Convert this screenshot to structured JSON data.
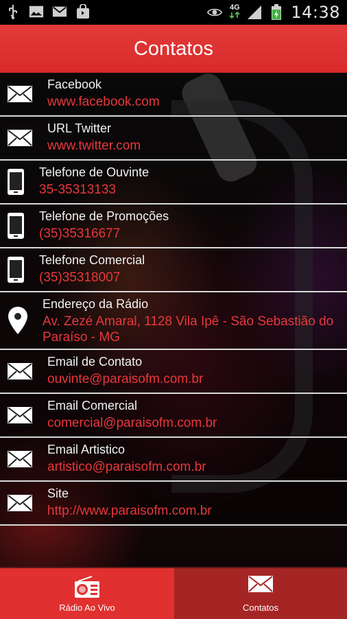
{
  "status_bar": {
    "network_label": "4G",
    "time": "14:38"
  },
  "header": {
    "title": "Contatos"
  },
  "contacts": [
    {
      "icon": "mail-icon",
      "label": "Facebook",
      "value": "www.facebook.com"
    },
    {
      "icon": "mail-icon",
      "label": "URL Twitter",
      "value": "www.twitter.com"
    },
    {
      "icon": "phone-icon",
      "label": "Telefone de Ouvinte",
      "value": "35-35313133"
    },
    {
      "icon": "phone-icon",
      "label": "Telefone de Promoções",
      "value": "(35)35316677"
    },
    {
      "icon": "phone-icon",
      "label": "Telefone Comercial",
      "value": "(35)35318007"
    },
    {
      "icon": "location-pin-icon",
      "label": "Endereço da Rádio",
      "value": "Av. Zezé Amaral, 1128 Vila Ipê - São Sebastião do Paraíso - MG"
    },
    {
      "icon": "mail-icon",
      "label": "Email de Contato",
      "value": "ouvinte@paraisofm.com.br"
    },
    {
      "icon": "mail-icon",
      "label": "Email Comercial",
      "value": "comercial@paraisofm.com.br"
    },
    {
      "icon": "mail-icon",
      "label": "Email Artistico",
      "value": "artistico@paraisofm.com.br"
    },
    {
      "icon": "mail-icon",
      "label": "Site",
      "value": "http://www.paraisofm.com.br"
    }
  ],
  "bottom_nav": {
    "tabs": [
      {
        "label": "Rádio Ao Vivo",
        "icon": "radio-icon",
        "selected": false
      },
      {
        "label": "Contatos",
        "icon": "mail-icon",
        "selected": true
      }
    ]
  },
  "colors": {
    "accent_red": "#e0302f",
    "selected_tab": "#a52524",
    "value_text": "#e8373c"
  }
}
